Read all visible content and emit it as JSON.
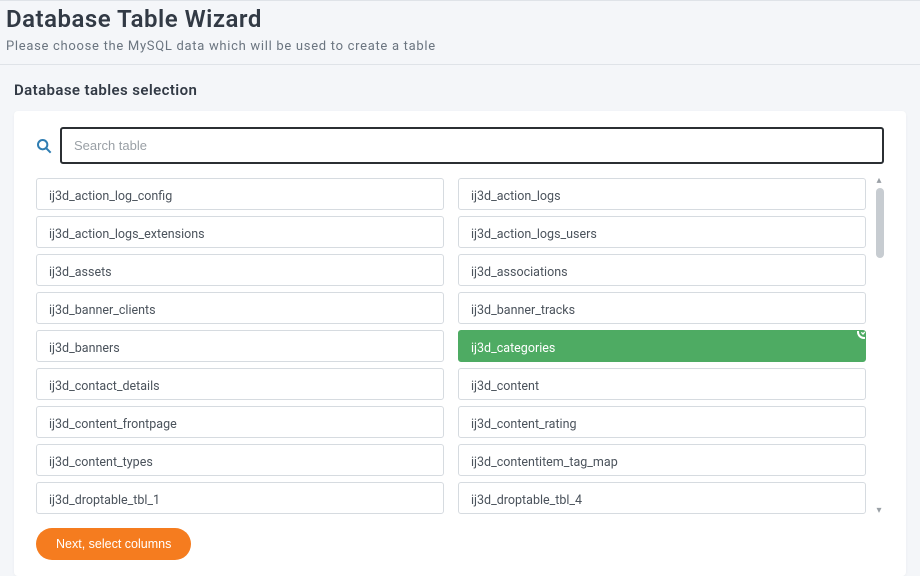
{
  "header": {
    "title": "Database Table Wizard",
    "subtitle": "Please choose the MySQL data which will be used to create a table"
  },
  "section": {
    "title": "Database tables selection"
  },
  "search": {
    "placeholder": "Search table",
    "value": ""
  },
  "tables": [
    {
      "name": "ij3d_action_log_config",
      "selected": false
    },
    {
      "name": "ij3d_action_logs",
      "selected": false
    },
    {
      "name": "ij3d_action_logs_extensions",
      "selected": false
    },
    {
      "name": "ij3d_action_logs_users",
      "selected": false
    },
    {
      "name": "ij3d_assets",
      "selected": false
    },
    {
      "name": "ij3d_associations",
      "selected": false
    },
    {
      "name": "ij3d_banner_clients",
      "selected": false
    },
    {
      "name": "ij3d_banner_tracks",
      "selected": false
    },
    {
      "name": "ij3d_banners",
      "selected": false
    },
    {
      "name": "ij3d_categories",
      "selected": true
    },
    {
      "name": "ij3d_contact_details",
      "selected": false
    },
    {
      "name": "ij3d_content",
      "selected": false
    },
    {
      "name": "ij3d_content_frontpage",
      "selected": false
    },
    {
      "name": "ij3d_content_rating",
      "selected": false
    },
    {
      "name": "ij3d_content_types",
      "selected": false
    },
    {
      "name": "ij3d_contentitem_tag_map",
      "selected": false
    },
    {
      "name": "ij3d_droptable_tbl_1",
      "selected": false
    },
    {
      "name": "ij3d_droptable_tbl_4",
      "selected": false
    }
  ],
  "footer": {
    "next_label": "Next, select columns"
  },
  "colors": {
    "accent_orange": "#f57c1f",
    "accent_green": "#4eab63"
  }
}
